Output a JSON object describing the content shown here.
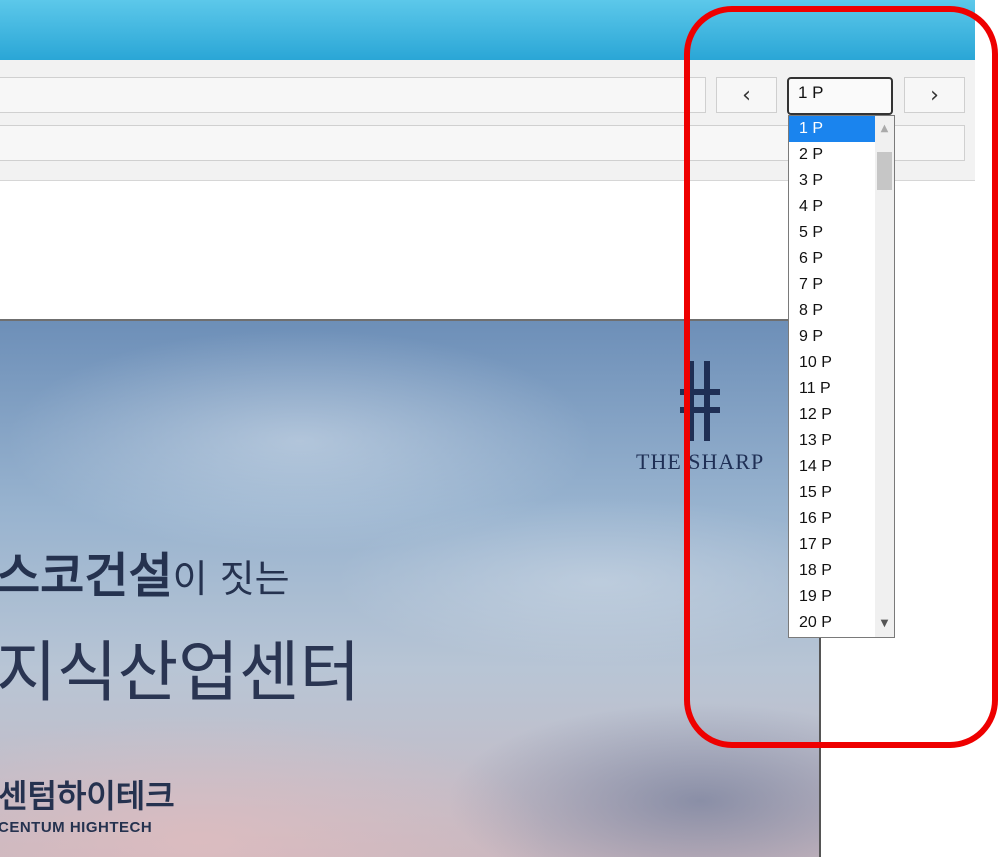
{
  "toolbar": {
    "prev_label": "‹",
    "next_label": "›",
    "page_select_value": "1 P"
  },
  "page_dropdown": {
    "options": [
      "1 P",
      "2 P",
      "3 P",
      "4 P",
      "5 P",
      "6 P",
      "7 P",
      "8 P",
      "9 P",
      "10 P",
      "11 P",
      "12 P",
      "13 P",
      "14 P",
      "15 P",
      "16 P",
      "17 P",
      "18 P",
      "19 P",
      "20 P"
    ],
    "selected_index": 0,
    "scroll_up_icon": "▲",
    "scroll_down_icon": "▼"
  },
  "banner": {
    "logo_text": "THE SHARP",
    "headline_bold": "스코건설",
    "headline_light": "이 짓는",
    "headline_line2": "지식산업센터",
    "brand_korean": "센텀하이테크",
    "brand_english": "CENTUM HIGHTECH"
  },
  "colors": {
    "titlebar": "#2aa6d6",
    "selected_option": "#1a84ee",
    "highlight_outline": "#ee0000"
  }
}
